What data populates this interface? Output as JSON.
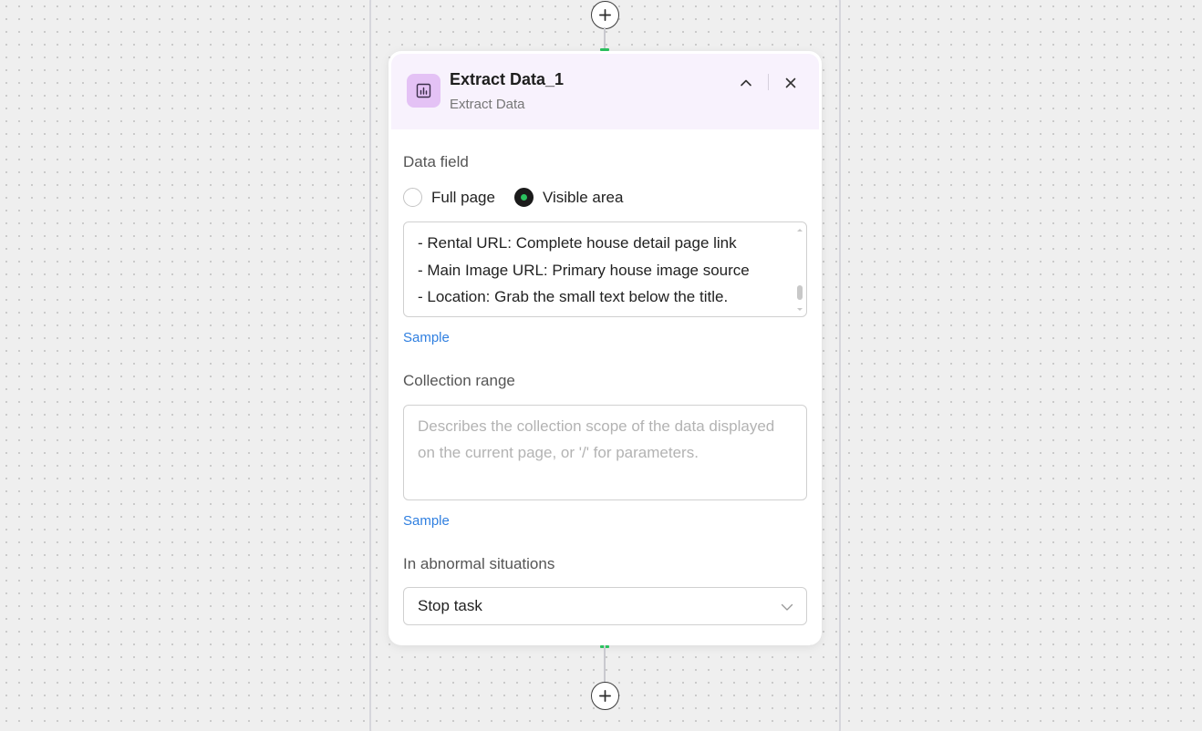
{
  "node": {
    "title": "Extract Data_1",
    "subtitle": "Extract Data",
    "icon": "bar-chart-icon",
    "accent_color": "#e4c2f5",
    "header_bg": "#f8f2fd"
  },
  "data_field": {
    "label": "Data field",
    "options": [
      {
        "label": "Full page",
        "checked": false
      },
      {
        "label": "Visible area",
        "checked": true
      }
    ],
    "text_lines": [
      "- Rental URL: Complete house detail page link",
      "- Main Image URL: Primary house image source",
      "- Location: Grab the small text below the title."
    ],
    "sample_label": "Sample"
  },
  "collection_range": {
    "label": "Collection range",
    "placeholder": "Describes the collection scope of the data displayed on the current page, or '/' for parameters.",
    "sample_label": "Sample"
  },
  "abnormal": {
    "label": "In abnormal situations",
    "selected": "Stop task"
  },
  "colors": {
    "connector_active": "#2bc25f",
    "link": "#2f7fe0",
    "radio_checked": "#1b1b1b"
  }
}
